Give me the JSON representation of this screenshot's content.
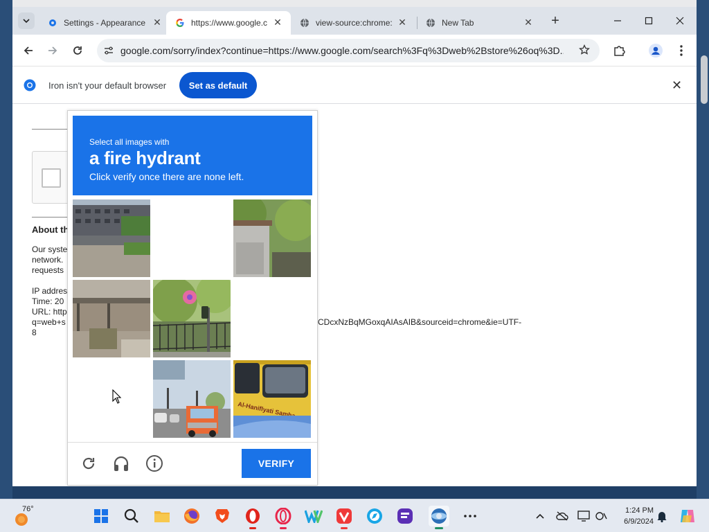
{
  "tabs": [
    {
      "title": "Settings - Appearance",
      "icon": "settings-gear-icon",
      "active": false
    },
    {
      "title": "https://www.google.com/sorry/index",
      "icon": "google-g-icon",
      "active": true
    },
    {
      "title": "view-source:chrome://",
      "icon": "globe-icon",
      "active": false
    },
    {
      "title": "New Tab",
      "icon": "globe-icon",
      "active": false
    }
  ],
  "address_bar": {
    "url": "google.com/sorry/index?continue=https://www.google.com/search%3Fq%3Dweb%2Bstore%26oq%3D..."
  },
  "infobar": {
    "message": "Iron isn't your default browser",
    "button": "Set as default"
  },
  "page": {
    "about_heading": "About th",
    "para_lines": [
      "Our syste",
      "network.",
      "requests"
    ],
    "ip_lines": [
      "IP addres",
      "Time: 20",
      "URL: http",
      "q=web+s",
      "8"
    ],
    "url_tail": "CDcxNzBqMGoxqAIAsAIB&sourceid=chrome&ie=UTF-"
  },
  "captcha": {
    "line1": "Select all images with",
    "target": "a fire hydrant",
    "line3": "Click verify once there are none left.",
    "verify_label": "VERIFY",
    "brand_color": "#1a73e8"
  },
  "taskbar": {
    "temperature": "76°",
    "time": "1:24 PM",
    "date": "6/9/2024"
  }
}
